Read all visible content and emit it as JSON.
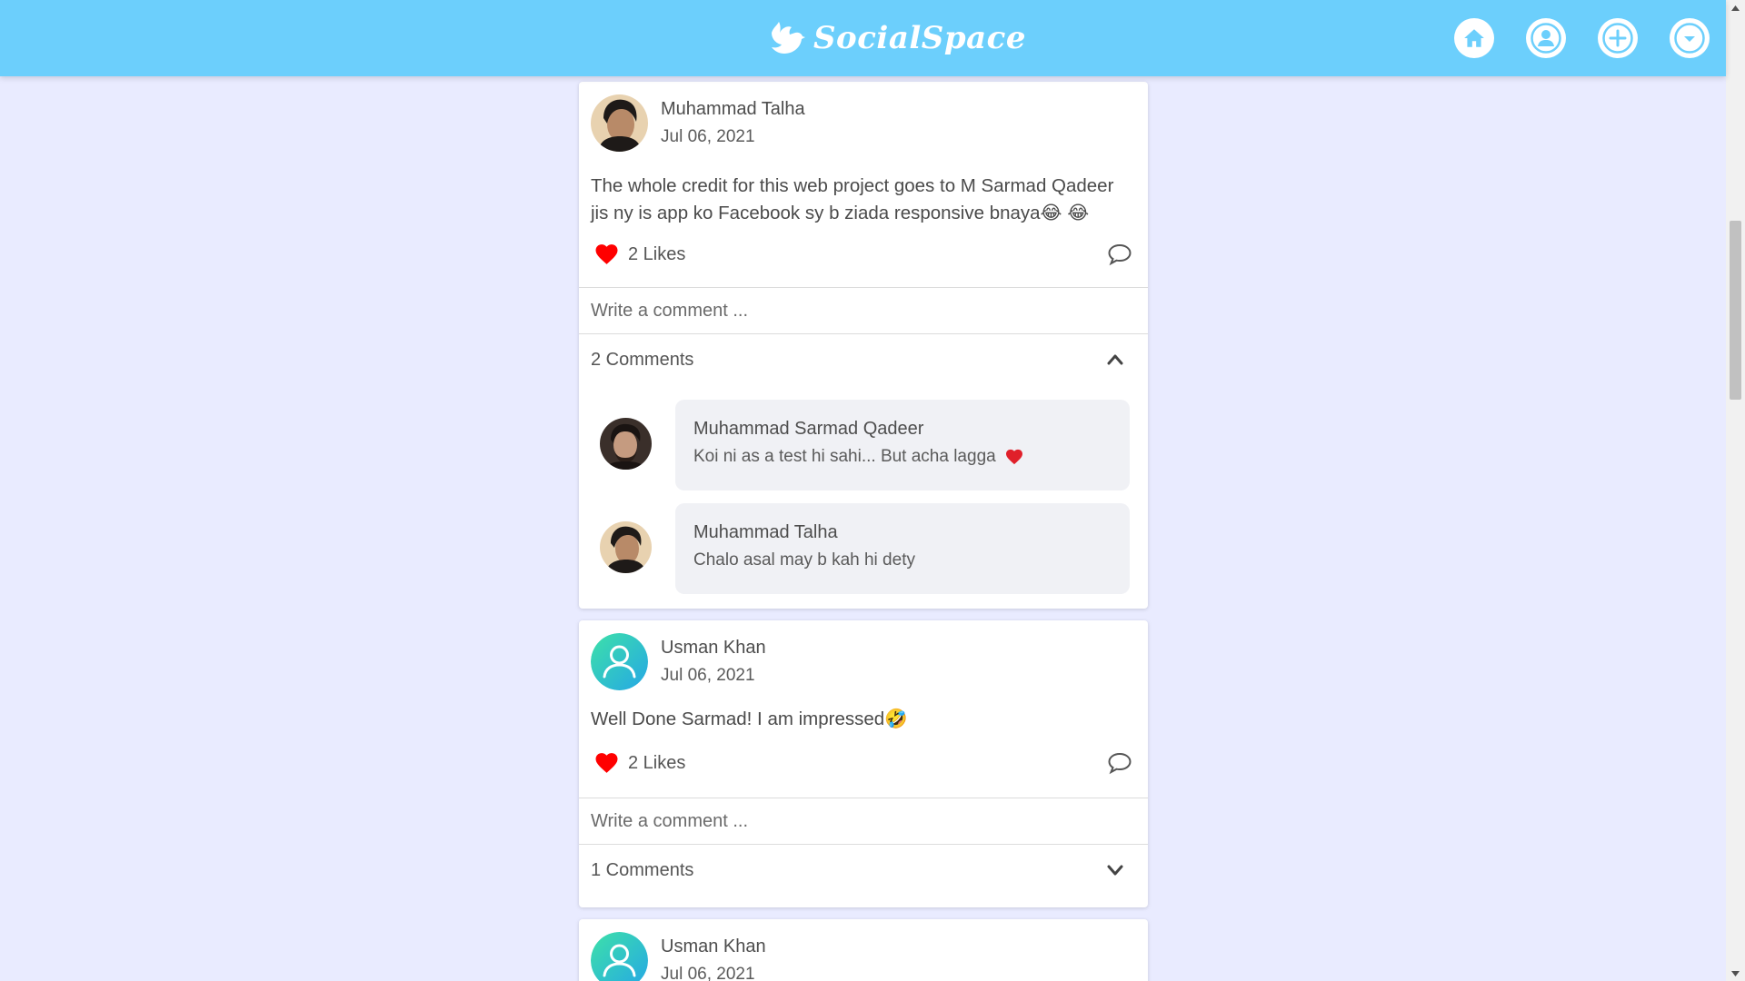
{
  "app": {
    "brand": "SocialSpace"
  },
  "nav": {
    "items": [
      {
        "name": "home",
        "icon": "home-icon"
      },
      {
        "name": "profile",
        "icon": "user-icon"
      },
      {
        "name": "create",
        "icon": "plus-icon"
      },
      {
        "name": "menu",
        "icon": "chevron-down-icon"
      }
    ]
  },
  "colors": {
    "navbar": "#6ccffc",
    "background": "#e9ebff",
    "heart": "#ff0000",
    "bubble": "#f0f1f5"
  },
  "posts": [
    {
      "author": "Muhammad Talha",
      "date": "Jul 06, 2021",
      "text": "The whole credit for this web project goes to M Sarmad Qadeer jis ny is app ko Facebook sy b ziada responsive bnaya😂 😂",
      "likes": "2 Likes",
      "comment_placeholder": "Write a comment ...",
      "comments_label": "2 Comments",
      "comments_expanded": true,
      "comments": [
        {
          "author": "Muhammad Sarmad Qadeer",
          "text": "Koi ni as a test hi sahi... But acha lagga"
        },
        {
          "author": "Muhammad Talha",
          "text": "Chalo asal may b kah hi dety"
        }
      ]
    },
    {
      "author": "Usman Khan",
      "date": "Jul 06, 2021",
      "text": "Well Done Sarmad! I am impressed🤣",
      "likes": "2 Likes",
      "comment_placeholder": "Write a comment ...",
      "comments_label": "1 Comments",
      "comments_expanded": false
    },
    {
      "author": "Usman Khan",
      "date": "Jul 06, 2021"
    }
  ]
}
